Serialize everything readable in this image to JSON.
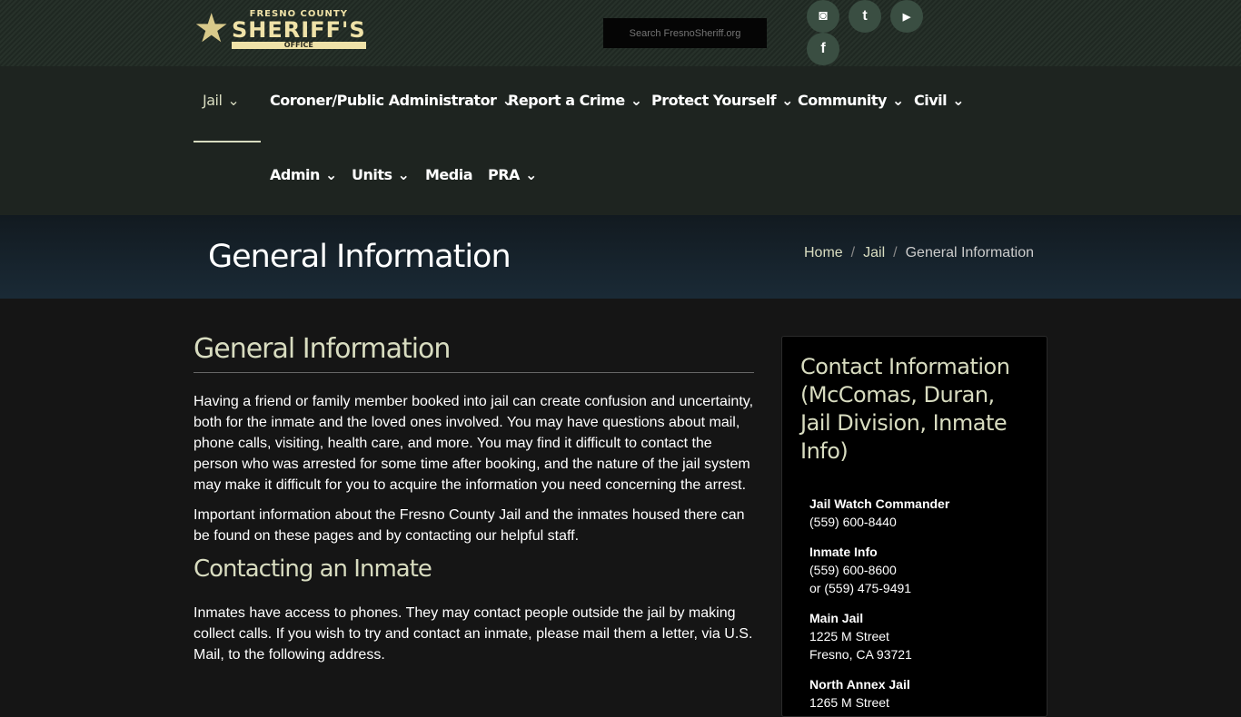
{
  "header": {
    "logo_text": [
      "FRESNO COUNTY",
      "SHERIFF'S",
      "OFFICE"
    ],
    "search_placeholder": "Search FresnoSheriff.org",
    "social": [
      {
        "icon": "instagram-icon",
        "glyph": "◙"
      },
      {
        "icon": "twitter-icon",
        "glyph": "🐦"
      },
      {
        "icon": "youtube-icon",
        "glyph": "▶"
      },
      {
        "icon": "facebook-icon",
        "glyph": "f"
      }
    ]
  },
  "nav": {
    "items": [
      {
        "label": "Jail",
        "dropdown": true,
        "active": true
      },
      {
        "label": "Coroner/Public Administrator",
        "dropdown": true
      },
      {
        "label": "Report a Crime",
        "dropdown": true
      },
      {
        "label": "Protect Yourself",
        "dropdown": true
      },
      {
        "label": "Community",
        "dropdown": true
      },
      {
        "label": "Civil",
        "dropdown": true
      },
      {
        "label": "Admin",
        "dropdown": true
      },
      {
        "label": "Units",
        "dropdown": true
      },
      {
        "label": "Media",
        "dropdown": false
      },
      {
        "label": "PRA",
        "dropdown": true
      }
    ]
  },
  "banner": {
    "title": "General Information",
    "breadcrumb": [
      "Home",
      "Jail",
      "General Information"
    ]
  },
  "main": {
    "heading": "General Information",
    "paragraphs": [
      "Having a friend or family member booked into jail can create confusion and uncertainty, both for the inmate and the loved ones involved. You may have questions about mail, phone calls, visiting, health care, and more. You may find it difficult to contact the person who was arrested for some time after booking, and the nature of the jail system may make it difficult for you to acquire the information you need concerning the arrest.",
      "Important information about the Fresno County Jail and the inmates housed there can be found on these pages and by contacting our helpful staff."
    ],
    "subheading": "Contacting an Inmate",
    "paragraph3": "Inmates have access to phones.  They may contact people outside the jail by making collect calls.  If you wish to try and contact an inmate, please mail them a letter, via U.S. Mail, to the following address."
  },
  "sidebar": {
    "title": "Contact Information (McComas, Duran, Jail Division, Inmate Info)",
    "blocks": [
      {
        "label": "Jail Watch Commander",
        "lines": [
          "(559) 600-8440"
        ]
      },
      {
        "label": "Inmate Info",
        "lines": [
          "(559) 600-8600",
          "or (559) 475-9491"
        ]
      },
      {
        "label": "Main Jail",
        "lines": [
          "1225 M Street",
          "Fresno, CA  93721"
        ]
      },
      {
        "label": "North Annex Jail",
        "lines": [
          "1265 M Street"
        ]
      }
    ]
  }
}
